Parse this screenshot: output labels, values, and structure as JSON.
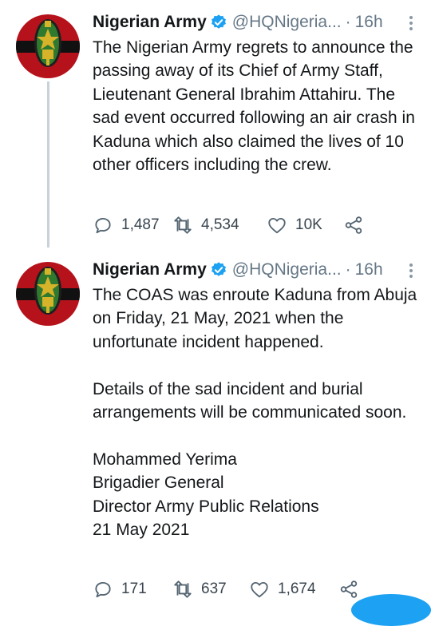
{
  "tweets": [
    {
      "author_name": "Nigerian Army",
      "handle": "@HQNigeria...",
      "separator": "·",
      "time": "16h",
      "paragraphs": [
        "The Nigerian Army regrets to announce the passing away of its Chief of Army Staff, Lieutenant General Ibrahim Attahiru. The sad event occurred following an air crash in Kaduna which also claimed the lives of 10 other officers including the crew."
      ],
      "replies": "1,487",
      "retweets": "4,534",
      "likes": "10K"
    },
    {
      "author_name": "Nigerian Army",
      "handle": "@HQNigeria...",
      "separator": "·",
      "time": "16h",
      "paragraphs": [
        "The COAS was enroute Kaduna from Abuja on Friday, 21 May, 2021 when the unfortunate incident happened.",
        "Details of the sad incident and burial arrangements will be communicated soon.",
        "Mohammed Yerima",
        "Brigadier General",
        "Director Army Public Relations",
        "21 May 2021"
      ],
      "replies": "171",
      "retweets": "637",
      "likes": "1,674"
    }
  ],
  "icons": {
    "avatar": "nigerian-army-crest",
    "verified": "verified-badge-icon",
    "reply": "reply-icon",
    "retweet": "retweet-icon",
    "like": "heart-icon",
    "share": "share-icon",
    "more": "more-vertical-icon"
  },
  "colors": {
    "avatar_red": "#b5121b",
    "avatar_black": "#111111",
    "crest_green": "#2f7a2f",
    "crest_gold": "#d7b32a",
    "verified_blue": "#1da1f2",
    "muted_text": "#657786",
    "thread_line": "#c9d2d9",
    "fab_blue": "#1da1f2"
  }
}
